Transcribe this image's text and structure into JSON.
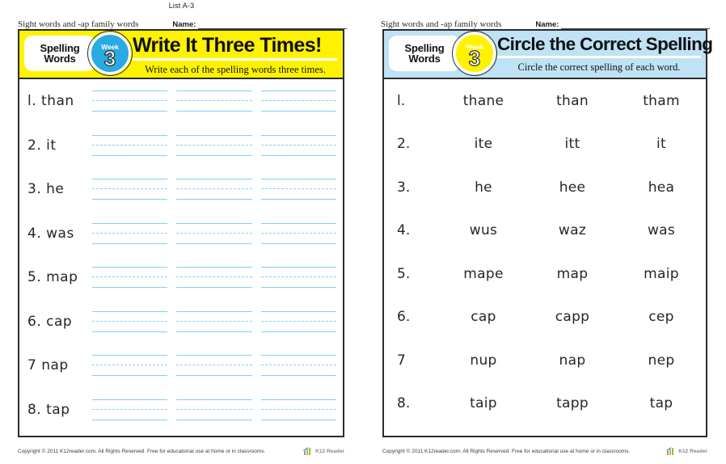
{
  "document": {
    "list_code": "List A-3",
    "subject_line": "Sight words and -ap family words",
    "name_label": "Name:"
  },
  "footer": {
    "copyright": "Copyright © 2011  K12reader.com. All Rights Reserved. Free for educational use at home or in classrooms.",
    "logo_text": "K12 Reader",
    "logo_icon": "bar-chart-logo-icon"
  },
  "worksheets": [
    {
      "id": "write-it-three-times",
      "badge_label": "Spelling Words",
      "badge_line1": "Spelling",
      "badge_line2": "Words",
      "week_word": "Week",
      "week_number": "3",
      "title": "Write It Three Times!",
      "subtitle": "Write each of  the spelling words three times.",
      "banner_color": "#fff200",
      "badge_color": "#29aae2",
      "line_color": "#7fd2f5",
      "items": [
        {
          "number": "l.",
          "word": "than"
        },
        {
          "number": "2.",
          "word": "it"
        },
        {
          "number": "3.",
          "word": "he"
        },
        {
          "number": "4.",
          "word": "was"
        },
        {
          "number": "5.",
          "word": "map"
        },
        {
          "number": "6.",
          "word": "cap"
        },
        {
          "number": "7",
          "word": "nap"
        },
        {
          "number": "8.",
          "word": "tap"
        }
      ]
    },
    {
      "id": "circle-the-correct-spelling",
      "badge_label": "Spelling Words",
      "badge_line1": "Spelling",
      "badge_line2": "Words",
      "week_word": "Week",
      "week_number": "3",
      "title": "Circle the Correct Spelling",
      "subtitle": "Circle the correct spelling of  each word.",
      "banner_color": "#bfe2f5",
      "badge_color": "#fff200",
      "items": [
        {
          "number": "l.",
          "options": [
            "thane",
            "than",
            "tham"
          ]
        },
        {
          "number": "2.",
          "options": [
            "ite",
            "itt",
            "it"
          ]
        },
        {
          "number": "3.",
          "options": [
            "he",
            "hee",
            "hea"
          ]
        },
        {
          "number": "4.",
          "options": [
            "wus",
            "waz",
            "was"
          ]
        },
        {
          "number": "5.",
          "options": [
            "mape",
            "map",
            "maip"
          ]
        },
        {
          "number": "6.",
          "options": [
            "cap",
            "capp",
            "cep"
          ]
        },
        {
          "number": "7",
          "options": [
            "nup",
            "nap",
            "nep"
          ]
        },
        {
          "number": "8.",
          "options": [
            "taip",
            "tapp",
            "tap"
          ]
        }
      ]
    }
  ]
}
